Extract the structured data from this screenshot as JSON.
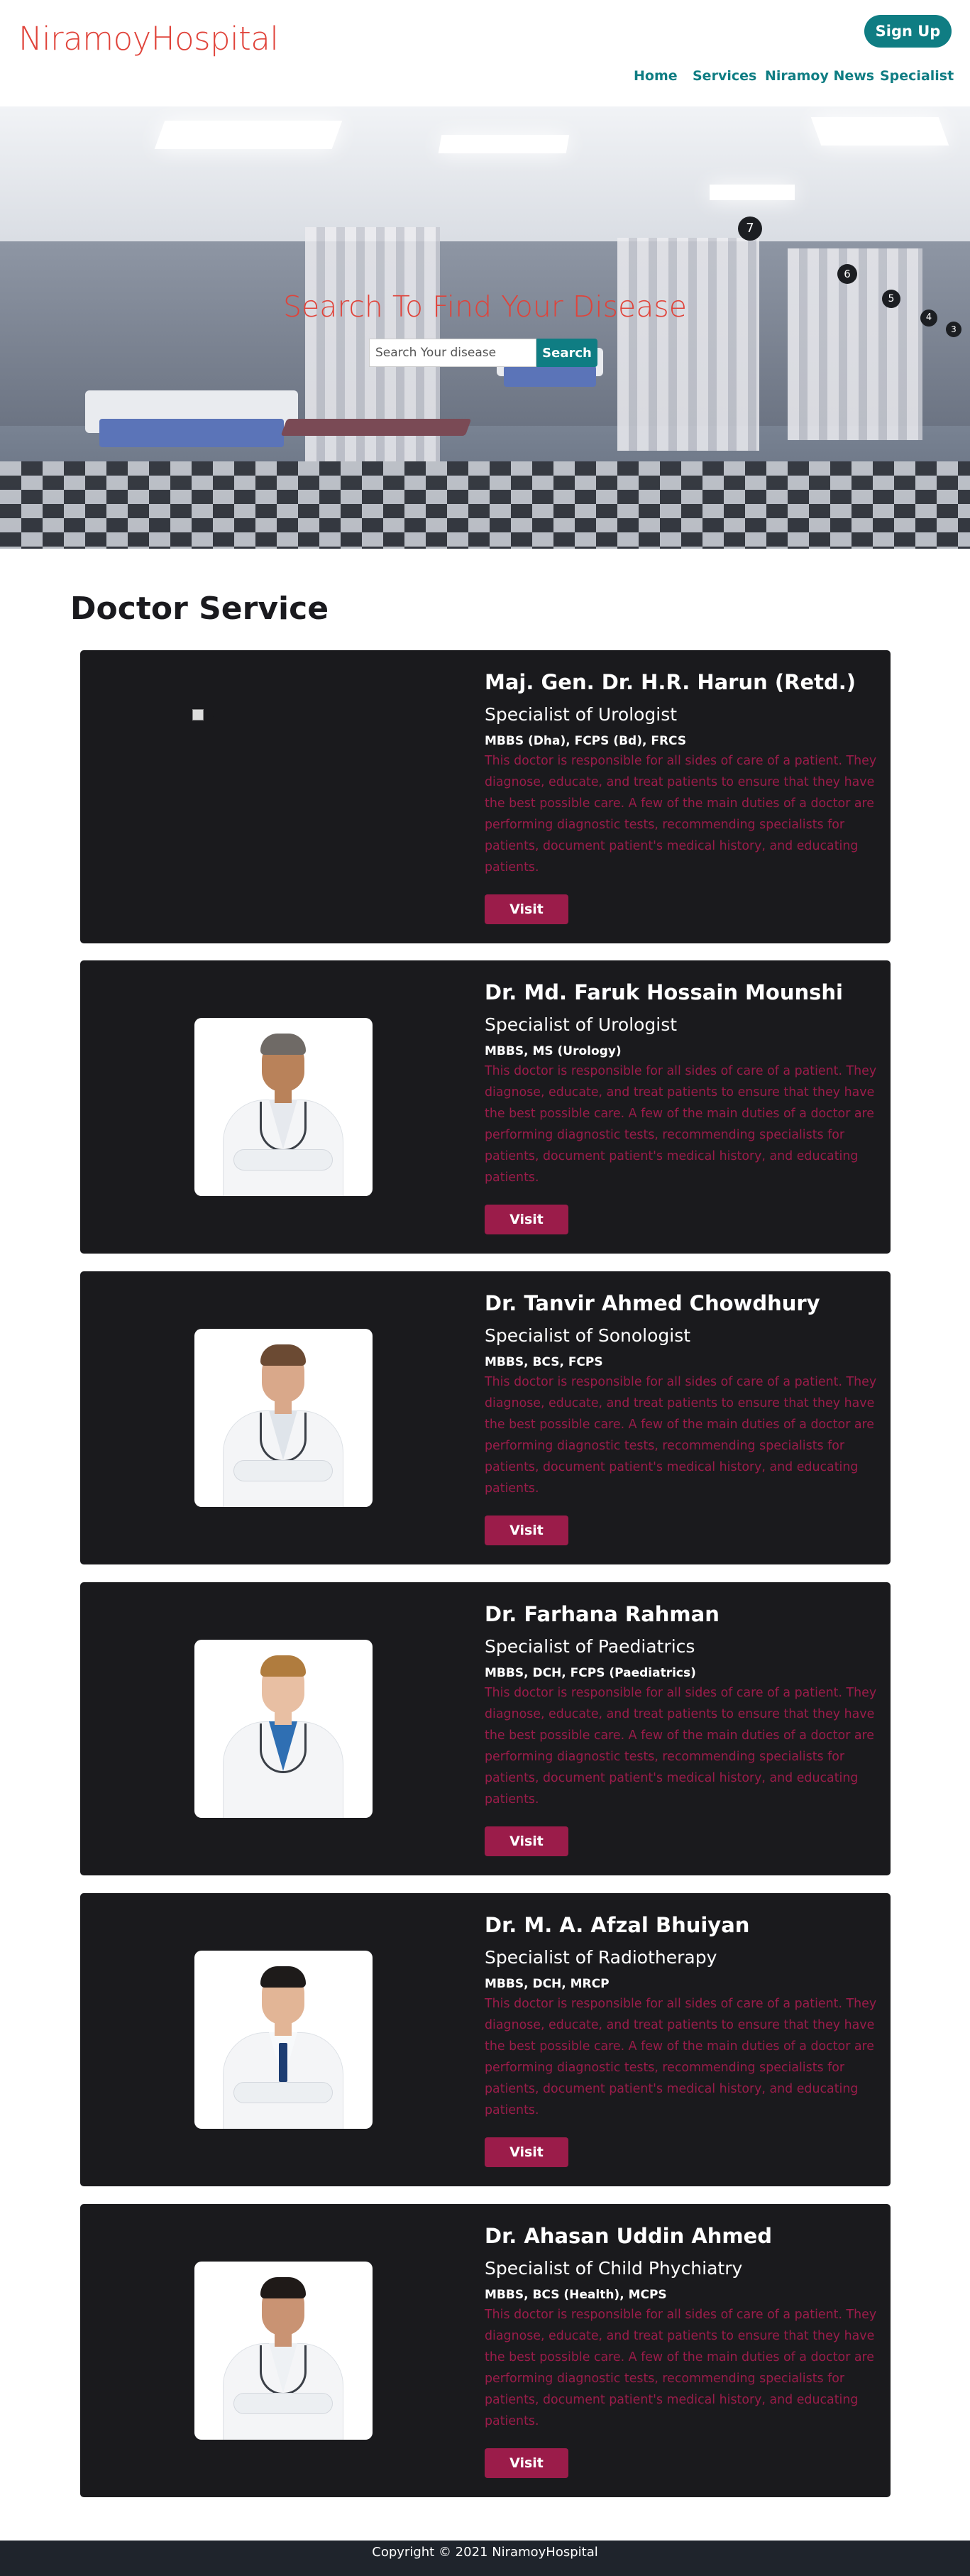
{
  "navbar": {
    "brand": "NiramoyHospital",
    "signup_label": "Sign Up",
    "links": [
      "Home",
      "Services",
      "Niramoy News",
      "Specialist"
    ]
  },
  "hero": {
    "title": "Search To Find Your Disease",
    "search_placeholder": "Search Your disease",
    "search_button": "Search"
  },
  "section": {
    "title": "Doctor Service"
  },
  "doctors": [
    {
      "name": "Maj. Gen. Dr. H.R. Harun (Retd.)",
      "specialty": "Specialist of Urologist",
      "degrees": "MBBS (Dha), FCPS (Bd), FRCS",
      "description": "This doctor is responsible for all sides of care of a patient. They diagnose, educate, and treat patients to ensure that they have the best possible care. A few of the main duties of a doctor are performing diagnostic tests, recommending specialists for patients, document patient's medical history, and educating patients.",
      "visit_label": "Visit",
      "photo_alt": "..."
    },
    {
      "name": "Dr. Md. Faruk Hossain Mounshi",
      "specialty": "Specialist of Urologist",
      "degrees": "MBBS, MS (Urology)",
      "description": "This doctor is responsible for all sides of care of a patient. They diagnose, educate, and treat patients to ensure that they have the best possible care. A few of the main duties of a doctor are performing diagnostic tests, recommending specialists for patients, document patient's medical history, and educating patients.",
      "visit_label": "Visit"
    },
    {
      "name": "Dr. Tanvir Ahmed Chowdhury",
      "specialty": "Specialist of Sonologist",
      "degrees": "MBBS, BCS, FCPS",
      "description": "This doctor is responsible for all sides of care of a patient. They diagnose, educate, and treat patients to ensure that they have the best possible care. A few of the main duties of a doctor are performing diagnostic tests, recommending specialists for patients, document patient's medical history, and educating patients.",
      "visit_label": "Visit"
    },
    {
      "name": "Dr. Farhana Rahman",
      "specialty": "Specialist of Paediatrics",
      "degrees": "MBBS, DCH, FCPS (Paediatrics)",
      "description": "This doctor is responsible for all sides of care of a patient. They diagnose, educate, and treat patients to ensure that they have the best possible care. A few of the main duties of a doctor are performing diagnostic tests, recommending specialists for patients, document patient's medical history, and educating patients.",
      "visit_label": "Visit"
    },
    {
      "name": "Dr. M. A. Afzal Bhuiyan",
      "specialty": "Specialist of Radiotherapy",
      "degrees": "MBBS, DCH, MRCP",
      "description": "This doctor is responsible for all sides of care of a patient. They diagnose, educate, and treat patients to ensure that they have the best possible care. A few of the main duties of a doctor are performing diagnostic tests, recommending specialists for patients, document patient's medical history, and educating patients.",
      "visit_label": "Visit"
    },
    {
      "name": "Dr. Ahasan Uddin Ahmed",
      "specialty": "Specialist of Child Phychiatry",
      "degrees": "MBBS, BCS (Health), MCPS",
      "description": "This doctor is responsible for all sides of care of a patient. They diagnose, educate, and treat patients to ensure that they have the best possible care. A few of the main duties of a doctor are performing diagnostic tests, recommending specialists for patients, document patient's medical history, and educating patients.",
      "visit_label": "Visit"
    }
  ],
  "footer": {
    "text": "Copyright © 2021 NiramoyHospital"
  },
  "colors": {
    "brand": "#e0433a",
    "accent": "#0f7d83",
    "card_bg": "#1a1a1d",
    "description_text": "#9b1c4a",
    "visit_button": "#9b1c4a",
    "footer_bg": "#1f242c"
  }
}
